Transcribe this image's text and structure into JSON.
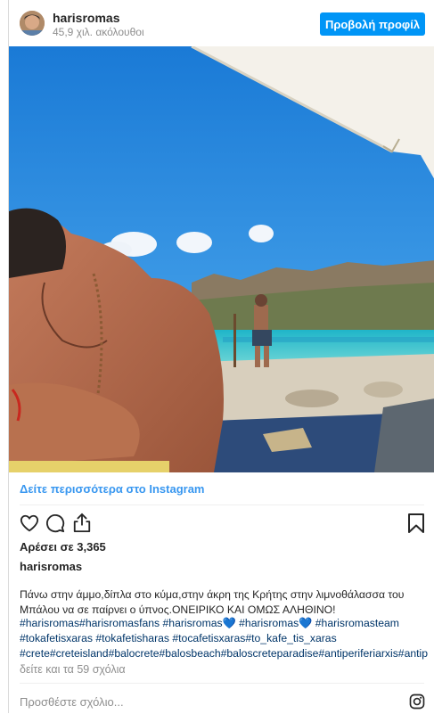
{
  "post": {
    "username": "harisromas",
    "followers": "45,9 χιλ. ακόλουθοι",
    "view_profile_label": "Προβολή προφίλ",
    "more_link": "Δείτε περισσότερα στο Instagram",
    "likes": "Αρέσει σε 3,365",
    "caption_user": "harisromas",
    "caption_line1": "Πάνω στην άμμο,δίπλα στο κύμα,στην άκρη της Κρήτης στην λιμνοθάλασσα του",
    "caption_line2": "Μπάλου να σε παίρνει ο ύπνος.ΟΝΕΙΡΙΚΟ ΚΑΙ ΟΜΩΣ ΑΛΗΘΙΝΟ!",
    "tags_line1": "#harisromas#harisromasfans #harisromas💙 #harisromas💙 #harisromasteam",
    "tags_line2": "#tokafetisxaras #tokafetisharas #tocafetisxaras#to_kafe_tis_xaras",
    "tags_line3": "#crete#creteisland#balocrete#balosbeach#baloscreteparadise#antiperiferiarxis#antip",
    "comments_link": "δείτε και τα 59 σχόλια",
    "add_comment_placeholder": "Προσθέστε σχόλιο..."
  },
  "icons": {
    "like": "heart-icon",
    "comment": "comment-icon",
    "share": "share-icon",
    "save": "bookmark-icon",
    "logo": "instagram-icon"
  },
  "colors": {
    "accent": "#0095f6",
    "link": "#3897f0",
    "hashtag": "#003569",
    "muted": "#8e8e8e"
  }
}
